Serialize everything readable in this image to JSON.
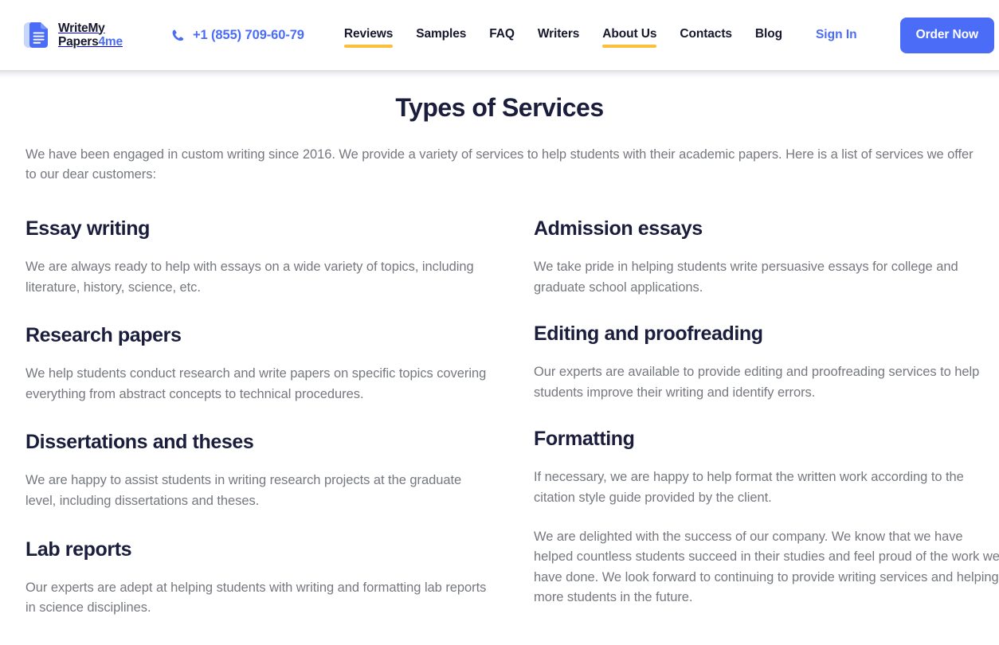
{
  "header": {
    "logo": {
      "icon": "document-icon",
      "line1": "WriteMy",
      "line2_main": "Papers",
      "line2_accent": "4me",
      "accent_color": "#4A6CF7"
    },
    "phone": {
      "icon": "phone-icon",
      "number": "+1 (855) 709-60-79",
      "color": "#4A6CF7"
    },
    "nav_items": [
      {
        "label": "Reviews",
        "underlined": true
      },
      {
        "label": "Samples",
        "underlined": false
      },
      {
        "label": "FAQ",
        "underlined": false
      },
      {
        "label": "Writers",
        "underlined": false
      },
      {
        "label": "About Us",
        "underlined": true
      },
      {
        "label": "Contacts",
        "underlined": false
      },
      {
        "label": "Blog",
        "underlined": false
      }
    ],
    "sign_in_label": "Sign In",
    "order_now_label": "Order Now",
    "underline_color": "#FBBF3C",
    "button_color": "#4A6CF7"
  },
  "main": {
    "title": "Types of Services",
    "intro": "We have been engaged in custom writing since 2016. We provide a variety of services to help students with their academic papers. Here is a list of services we offer to our dear customers:",
    "left_column": [
      {
        "title": "Essay writing",
        "desc": "We are always ready to help with essays on a wide variety of topics, including literature, history, science, etc."
      },
      {
        "title": "Research papers",
        "desc": "We help students conduct research and write papers on specific topics covering everything from abstract concepts to technical procedures."
      },
      {
        "title": "Dissertations and theses",
        "desc": "We are happy to assist students in writing research projects at the graduate level, including dissertations and theses."
      },
      {
        "title": "Lab reports",
        "desc": "Our experts are adept at helping students with writing and formatting lab reports in science disciplines."
      }
    ],
    "right_column": [
      {
        "title": "Admission essays",
        "desc": "We take pride in helping students write persuasive essays for college and graduate school applications."
      },
      {
        "title": "Editing and proofreading",
        "desc": "Our experts are available to provide editing and proofreading services to help students improve their writing and identify errors."
      },
      {
        "title": "Formatting",
        "desc": "If necessary, we are happy to help format the written work according to the citation style guide provided by the client."
      }
    ],
    "closing": "We are delighted with the success of our company. We know that we have helped countless students succeed in their studies and feel proud of the work we have done. We look forward to continuing to provide writing services and helping more students in the future."
  }
}
